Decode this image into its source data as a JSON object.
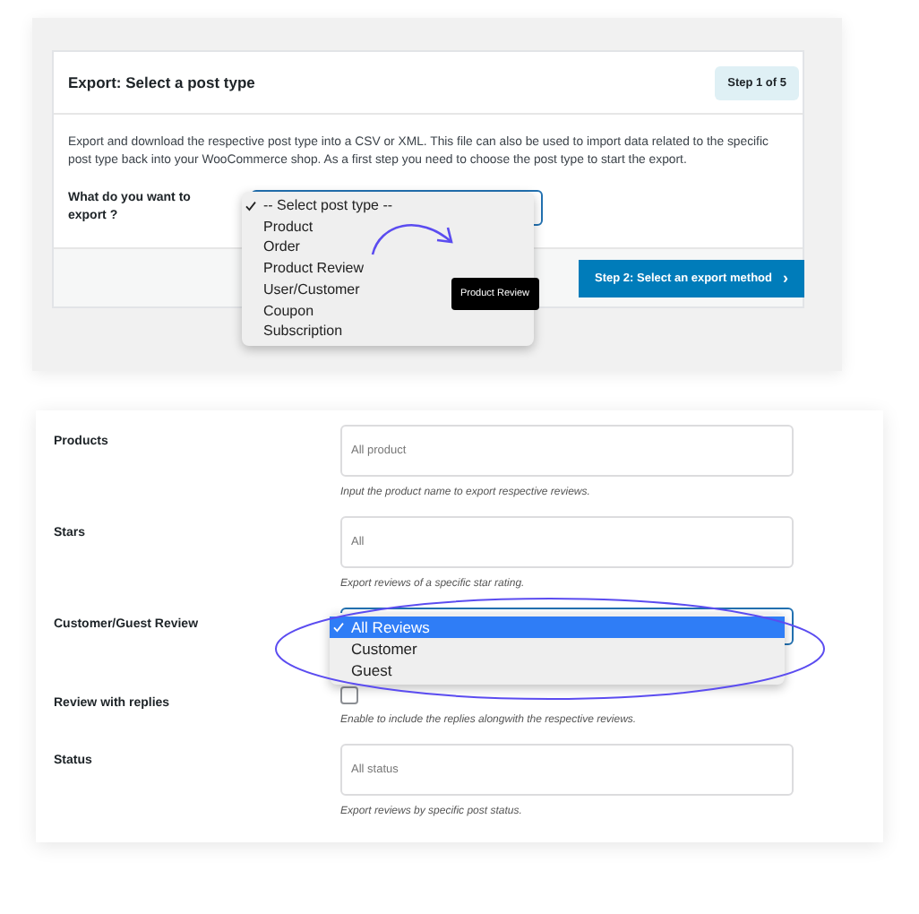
{
  "export_step": {
    "title": "Export: Select a post type",
    "step_badge": "Step 1 of 5",
    "description": "Export and download the respective post type into a CSV or XML. This file can also be used to import data related to the specific post type back into your WooCommerce shop. As a first step you need to choose the post type to start the export.",
    "field_label": "What do you want to export ?",
    "post_type_options": [
      {
        "label": "-- Select post type --",
        "selected": true
      },
      {
        "label": "Product",
        "selected": false
      },
      {
        "label": "Order",
        "selected": false
      },
      {
        "label": "Product Review",
        "selected": false
      },
      {
        "label": "User/Customer",
        "selected": false
      },
      {
        "label": "Coupon",
        "selected": false
      },
      {
        "label": "Subscription",
        "selected": false
      }
    ],
    "tooltip": "Product Review",
    "next_button": "Step 2: Select an export method",
    "next_icon": "›"
  },
  "filters": [
    {
      "kind": "text",
      "label": "Products",
      "placeholder": "All product",
      "hint": "Input the product name to export respective reviews."
    },
    {
      "kind": "text",
      "label": "Stars",
      "placeholder": "All",
      "hint": "Export reviews of a specific star rating."
    },
    {
      "kind": "select",
      "label": "Customer/Guest Review",
      "options": [
        {
          "label": "All Reviews",
          "selected": true
        },
        {
          "label": "Customer",
          "selected": false
        },
        {
          "label": "Guest",
          "selected": false
        }
      ]
    },
    {
      "kind": "checkbox",
      "label": "Review with replies",
      "checked": false,
      "hint": "Enable to include the replies alongwith the respective reviews."
    },
    {
      "kind": "text",
      "label": "Status",
      "placeholder": "All status",
      "hint": "Export reviews by specific post status."
    }
  ]
}
